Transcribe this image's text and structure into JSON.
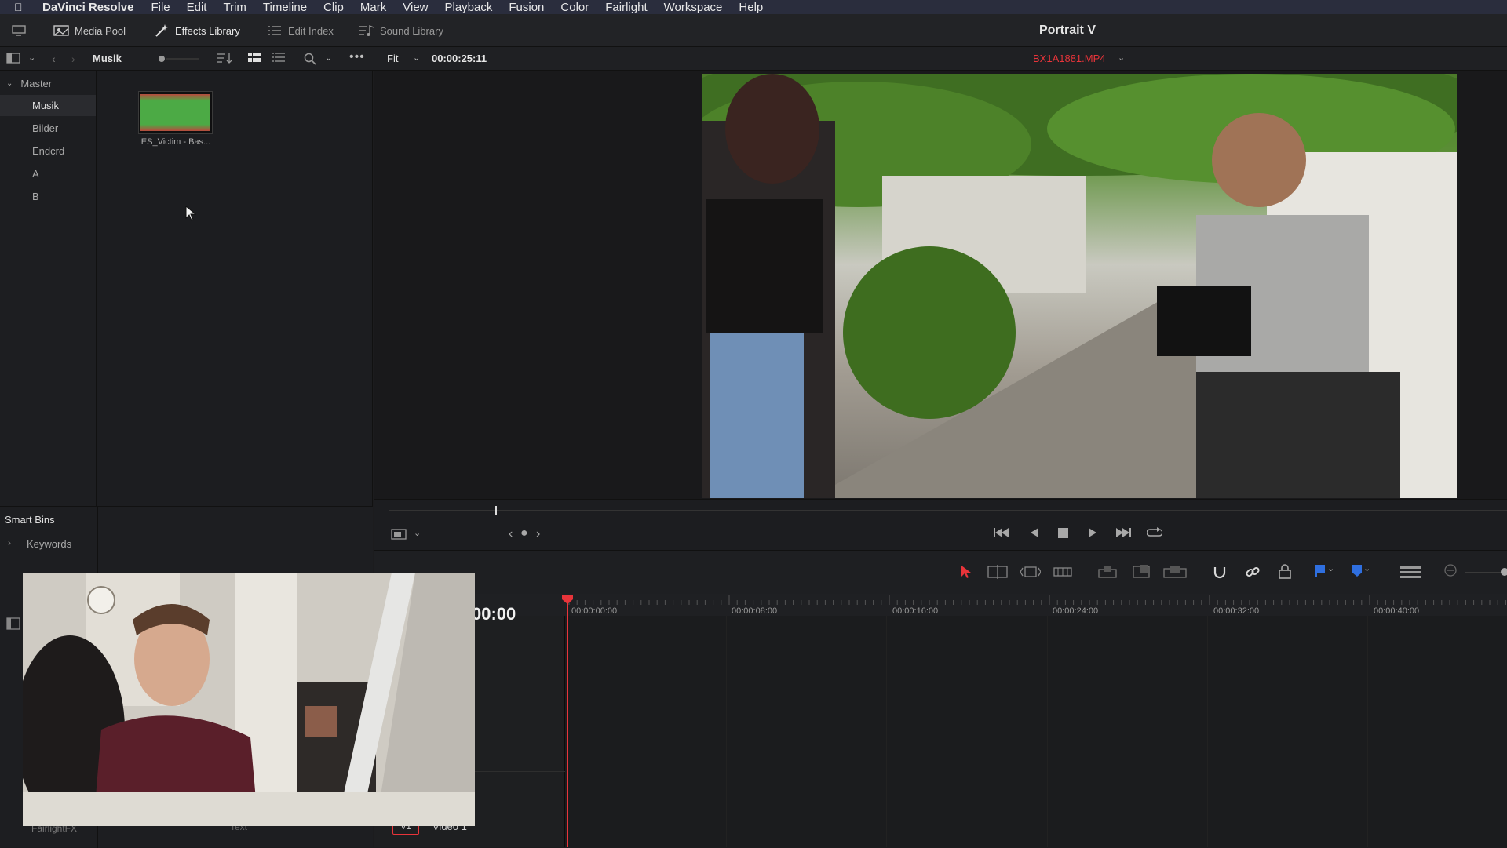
{
  "menubar": {
    "app_name": "DaVinci Resolve",
    "items": [
      "File",
      "Edit",
      "Trim",
      "Timeline",
      "Clip",
      "Mark",
      "View",
      "Playback",
      "Fusion",
      "Color",
      "Fairlight",
      "Workspace",
      "Help"
    ]
  },
  "toolbar": {
    "media_pool": "Media Pool",
    "effects_library": "Effects Library",
    "edit_index": "Edit Index",
    "sound_library": "Sound Library",
    "project_title": "Portrait V"
  },
  "subbar": {
    "bin_name": "Musik",
    "zoom": "Fit",
    "timecode": "00:00:25:11",
    "clip_name": "BX1A1881.MP4"
  },
  "bins": {
    "master": "Master",
    "items": [
      "Musik",
      "Bilder",
      "Endcrd",
      "A",
      "B"
    ]
  },
  "media": {
    "clip_label": "ES_Victim - Bas..."
  },
  "smart_bins": {
    "title": "Smart Bins",
    "keywords": "Keywords",
    "fairlightfx": "FairlightFX",
    "text": "Text"
  },
  "timeline": {
    "current_tc": "00:00",
    "ticks": [
      "00:00:00:00",
      "00:00:08:00",
      "00:00:16:00",
      "00:00:24:00",
      "00:00:32:00",
      "00:00:40:00"
    ],
    "track_name": "Video 1",
    "track_id": "V1"
  },
  "colors": {
    "accent_red": "#e8343a",
    "accent_blue": "#2f6fe0",
    "bg": "#1c1c1e"
  }
}
